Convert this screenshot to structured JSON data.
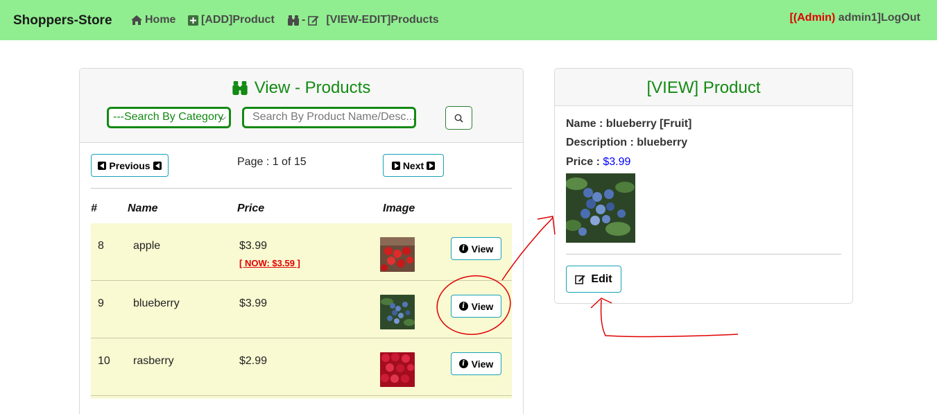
{
  "navbar": {
    "brand": "Shoppers-Store",
    "home": "Home",
    "add_product": "[ADD]Product",
    "view_edit_sep": "-",
    "view_edit": "[VIEW-EDIT]Products",
    "bracket_open": "[",
    "admin_label": "(Admin)",
    "user_logout": " admin1]LogOut",
    "background": "#90ee90"
  },
  "list_card": {
    "title": "View - Products",
    "category_select": "---Search By Category",
    "search_placeholder": "Search By Product Name/Desc...",
    "prev_label": "Previous",
    "next_label": "Next",
    "page_text": "Page : 1 of 15",
    "columns": [
      "#",
      "Name",
      "Price",
      "Image"
    ],
    "view_label": "View",
    "rows": [
      {
        "id": "8",
        "name": "apple",
        "price": "$3.99",
        "sale": "[ NOW: $3.59 ]",
        "image": "apples"
      },
      {
        "id": "9",
        "name": "blueberry",
        "price": "$3.99",
        "sale": "",
        "image": "blueberries"
      },
      {
        "id": "10",
        "name": "rasberry",
        "price": "$2.99",
        "sale": "",
        "image": "raspberries"
      }
    ],
    "row_bg": "#f9f9d2",
    "accent": "#138a13"
  },
  "detail_card": {
    "title": "[VIEW] Product",
    "name_line": "Name : blueberry [Fruit]",
    "desc_line": "Description : blueberry",
    "price_label": "Price : ",
    "price_value": "$3.99",
    "image": "blueberries",
    "edit_label": "Edit"
  },
  "annotations": {
    "color": "#e00000"
  }
}
